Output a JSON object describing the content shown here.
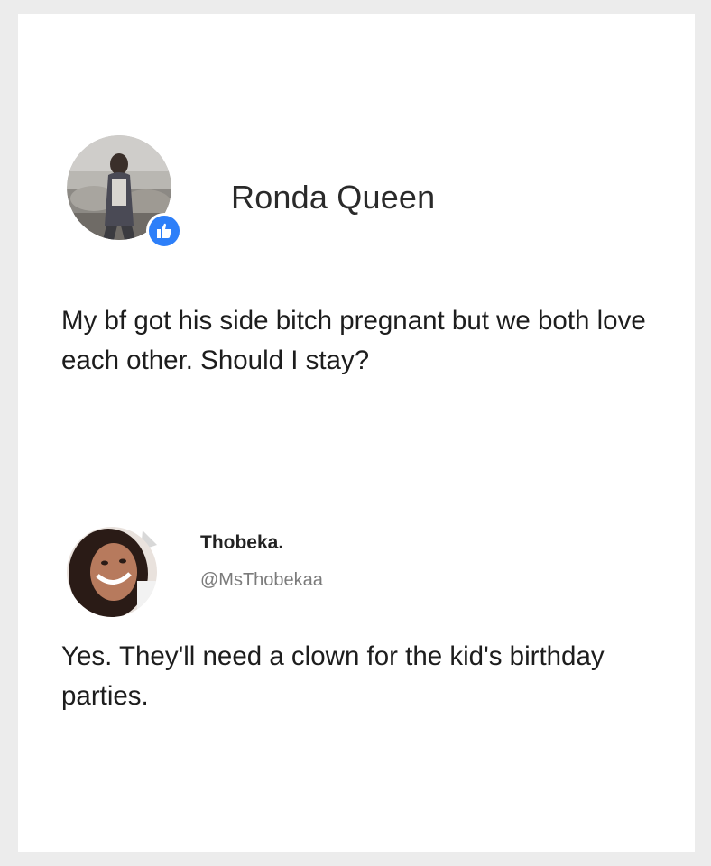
{
  "post": {
    "author_name": "Ronda Queen",
    "avatar_icon": "profile-photo",
    "badge_icon": "thumbs-up-icon",
    "badge_color": "#2d7ff9",
    "text": "My bf got his side bitch pregnant but we both love each other. Should I stay?"
  },
  "reply": {
    "display_name": "Thobeka.",
    "handle": "@MsThobekaa",
    "avatar_icon": "profile-photo",
    "text": "Yes. They'll need a clown for the kid's birthday parties."
  }
}
